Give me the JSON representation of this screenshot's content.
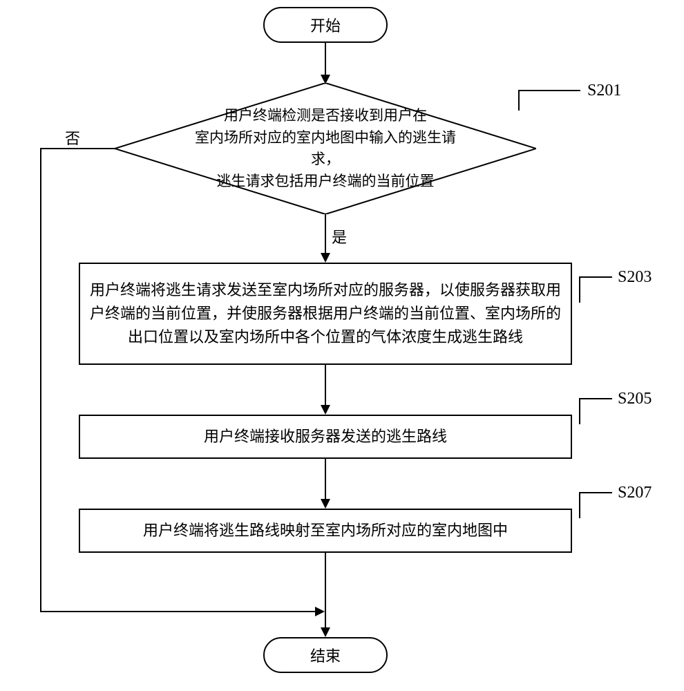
{
  "flow": {
    "start": "开始",
    "end": "结束",
    "decision": "用户终端检测是否接收到用户在\n室内场所对应的室内地图中输入的逃生请求，\n逃生请求包括用户终端的当前位置",
    "s203": "用户终端将逃生请求发送至室内场所对应的服务器，以使服务器获取用户终端的当前位置，并使服务器根据用户终端的当前位置、室内场所的出口位置以及室内场所中各个位置的气体浓度生成逃生路线",
    "s205": "用户终端接收服务器发送的逃生路线",
    "s207": "用户终端将逃生路线映射至室内场所对应的室内地图中",
    "yes": "是",
    "no": "否"
  },
  "labels": {
    "s201": "S201",
    "s203": "S203",
    "s205": "S205",
    "s207": "S207"
  }
}
